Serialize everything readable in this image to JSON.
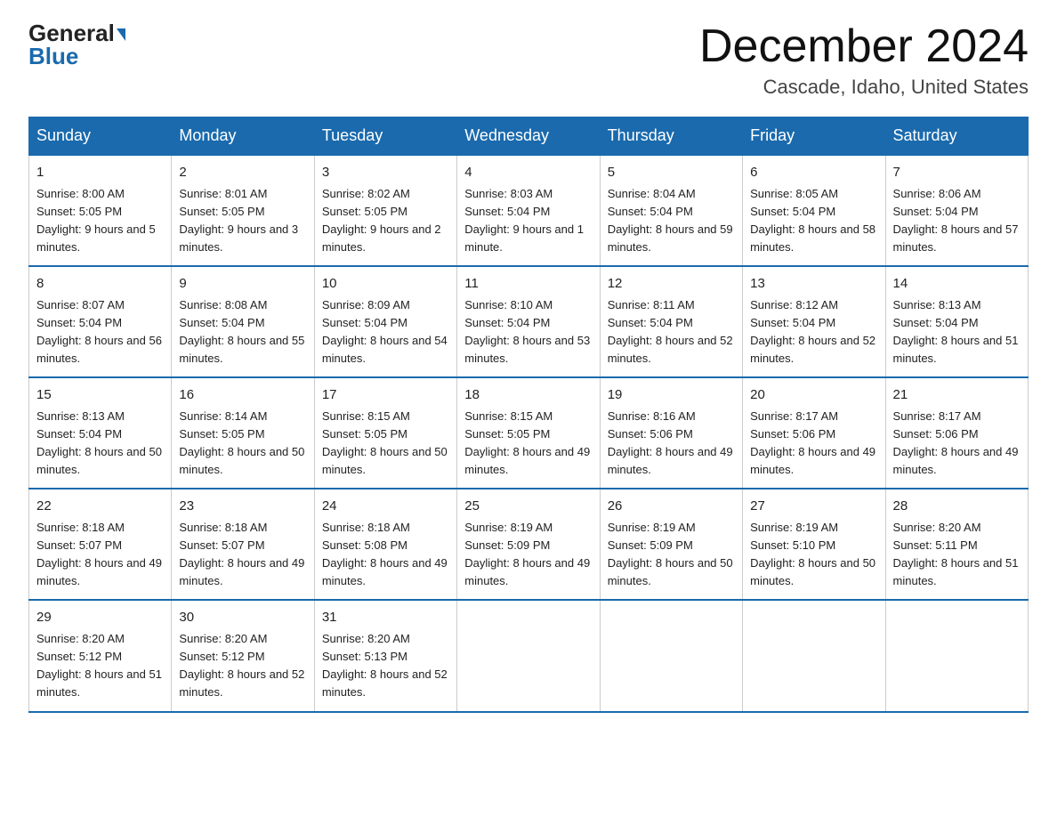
{
  "header": {
    "logo_general": "General",
    "logo_blue": "Blue",
    "title": "December 2024",
    "subtitle": "Cascade, Idaho, United States"
  },
  "days_of_week": [
    "Sunday",
    "Monday",
    "Tuesday",
    "Wednesday",
    "Thursday",
    "Friday",
    "Saturday"
  ],
  "weeks": [
    [
      {
        "day": "1",
        "sunrise": "8:00 AM",
        "sunset": "5:05 PM",
        "daylight": "9 hours and 5 minutes."
      },
      {
        "day": "2",
        "sunrise": "8:01 AM",
        "sunset": "5:05 PM",
        "daylight": "9 hours and 3 minutes."
      },
      {
        "day": "3",
        "sunrise": "8:02 AM",
        "sunset": "5:05 PM",
        "daylight": "9 hours and 2 minutes."
      },
      {
        "day": "4",
        "sunrise": "8:03 AM",
        "sunset": "5:04 PM",
        "daylight": "9 hours and 1 minute."
      },
      {
        "day": "5",
        "sunrise": "8:04 AM",
        "sunset": "5:04 PM",
        "daylight": "8 hours and 59 minutes."
      },
      {
        "day": "6",
        "sunrise": "8:05 AM",
        "sunset": "5:04 PM",
        "daylight": "8 hours and 58 minutes."
      },
      {
        "day": "7",
        "sunrise": "8:06 AM",
        "sunset": "5:04 PM",
        "daylight": "8 hours and 57 minutes."
      }
    ],
    [
      {
        "day": "8",
        "sunrise": "8:07 AM",
        "sunset": "5:04 PM",
        "daylight": "8 hours and 56 minutes."
      },
      {
        "day": "9",
        "sunrise": "8:08 AM",
        "sunset": "5:04 PM",
        "daylight": "8 hours and 55 minutes."
      },
      {
        "day": "10",
        "sunrise": "8:09 AM",
        "sunset": "5:04 PM",
        "daylight": "8 hours and 54 minutes."
      },
      {
        "day": "11",
        "sunrise": "8:10 AM",
        "sunset": "5:04 PM",
        "daylight": "8 hours and 53 minutes."
      },
      {
        "day": "12",
        "sunrise": "8:11 AM",
        "sunset": "5:04 PM",
        "daylight": "8 hours and 52 minutes."
      },
      {
        "day": "13",
        "sunrise": "8:12 AM",
        "sunset": "5:04 PM",
        "daylight": "8 hours and 52 minutes."
      },
      {
        "day": "14",
        "sunrise": "8:13 AM",
        "sunset": "5:04 PM",
        "daylight": "8 hours and 51 minutes."
      }
    ],
    [
      {
        "day": "15",
        "sunrise": "8:13 AM",
        "sunset": "5:04 PM",
        "daylight": "8 hours and 50 minutes."
      },
      {
        "day": "16",
        "sunrise": "8:14 AM",
        "sunset": "5:05 PM",
        "daylight": "8 hours and 50 minutes."
      },
      {
        "day": "17",
        "sunrise": "8:15 AM",
        "sunset": "5:05 PM",
        "daylight": "8 hours and 50 minutes."
      },
      {
        "day": "18",
        "sunrise": "8:15 AM",
        "sunset": "5:05 PM",
        "daylight": "8 hours and 49 minutes."
      },
      {
        "day": "19",
        "sunrise": "8:16 AM",
        "sunset": "5:06 PM",
        "daylight": "8 hours and 49 minutes."
      },
      {
        "day": "20",
        "sunrise": "8:17 AM",
        "sunset": "5:06 PM",
        "daylight": "8 hours and 49 minutes."
      },
      {
        "day": "21",
        "sunrise": "8:17 AM",
        "sunset": "5:06 PM",
        "daylight": "8 hours and 49 minutes."
      }
    ],
    [
      {
        "day": "22",
        "sunrise": "8:18 AM",
        "sunset": "5:07 PM",
        "daylight": "8 hours and 49 minutes."
      },
      {
        "day": "23",
        "sunrise": "8:18 AM",
        "sunset": "5:07 PM",
        "daylight": "8 hours and 49 minutes."
      },
      {
        "day": "24",
        "sunrise": "8:18 AM",
        "sunset": "5:08 PM",
        "daylight": "8 hours and 49 minutes."
      },
      {
        "day": "25",
        "sunrise": "8:19 AM",
        "sunset": "5:09 PM",
        "daylight": "8 hours and 49 minutes."
      },
      {
        "day": "26",
        "sunrise": "8:19 AM",
        "sunset": "5:09 PM",
        "daylight": "8 hours and 50 minutes."
      },
      {
        "day": "27",
        "sunrise": "8:19 AM",
        "sunset": "5:10 PM",
        "daylight": "8 hours and 50 minutes."
      },
      {
        "day": "28",
        "sunrise": "8:20 AM",
        "sunset": "5:11 PM",
        "daylight": "8 hours and 51 minutes."
      }
    ],
    [
      {
        "day": "29",
        "sunrise": "8:20 AM",
        "sunset": "5:12 PM",
        "daylight": "8 hours and 51 minutes."
      },
      {
        "day": "30",
        "sunrise": "8:20 AM",
        "sunset": "5:12 PM",
        "daylight": "8 hours and 52 minutes."
      },
      {
        "day": "31",
        "sunrise": "8:20 AM",
        "sunset": "5:13 PM",
        "daylight": "8 hours and 52 minutes."
      },
      null,
      null,
      null,
      null
    ]
  ],
  "labels": {
    "sunrise": "Sunrise:",
    "sunset": "Sunset:",
    "daylight": "Daylight:"
  }
}
